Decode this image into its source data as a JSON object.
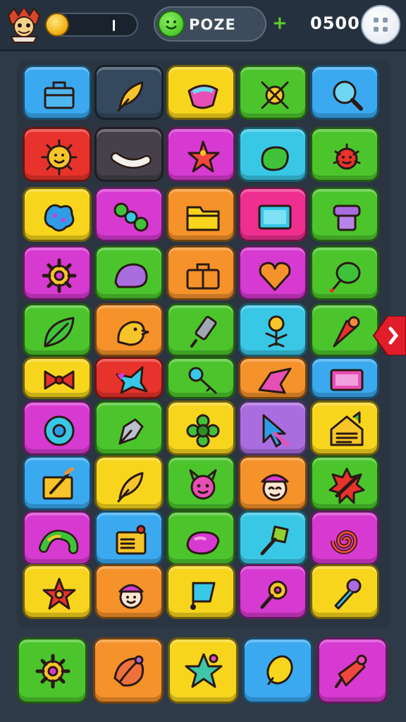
{
  "header": {
    "mode_label": "POZE",
    "score": "0500",
    "plus_symbol": "+"
  },
  "colors": {
    "background": "#2f3a48",
    "accent_green": "#5cd02a",
    "side_tab": "#e11d2a"
  },
  "palette": {
    "blue": "#3aa9f0",
    "navy": "#34495e",
    "yellow": "#f7d51d",
    "green": "#4cc52d",
    "red": "#e8322c",
    "dark": "#45404a",
    "magenta": "#d63ad0",
    "cyan": "#39c7e6",
    "orange": "#f5922a",
    "lime": "#8fd22f",
    "purple": "#a96ddf",
    "pink": "#ee2f8f"
  },
  "board": {
    "rows": [
      [
        {
          "color": "blue",
          "icon": "bag-icon"
        },
        {
          "color": "navy",
          "icon": "feather-icon"
        },
        {
          "color": "yellow",
          "icon": "gem-icon"
        },
        {
          "color": "green",
          "icon": "cross-ring-icon"
        },
        {
          "color": "blue",
          "icon": "magnifier-icon"
        }
      ],
      [
        {
          "color": "red",
          "icon": "sun-face-icon"
        },
        {
          "color": "dark",
          "icon": "worm-icon"
        },
        {
          "color": "magenta",
          "icon": "star-bolt-icon"
        },
        {
          "color": "cyan",
          "icon": "frog-icon"
        },
        {
          "color": "green",
          "icon": "bug-icon"
        }
      ],
      [
        {
          "color": "yellow",
          "icon": "blob-icon"
        },
        {
          "color": "magenta",
          "icon": "beads-icon"
        },
        {
          "color": "orange",
          "icon": "folder-icon"
        },
        {
          "color": "pink",
          "icon": "screen-icon"
        },
        {
          "color": "green",
          "icon": "jar-icon"
        }
      ],
      [
        {
          "color": "magenta",
          "icon": "gear-icon"
        },
        {
          "color": "green",
          "icon": "slug-icon"
        },
        {
          "color": "orange",
          "icon": "suitcase-icon"
        },
        {
          "color": "magenta",
          "icon": "heart-icon"
        },
        {
          "color": "green",
          "icon": "balloon-icon"
        }
      ],
      [
        {
          "color": "green",
          "icon": "leaf-icon"
        },
        {
          "color": "orange",
          "icon": "chick-icon"
        },
        {
          "color": "green",
          "icon": "marker-icon"
        },
        {
          "color": "cyan",
          "icon": "plant-icon"
        },
        {
          "color": "green",
          "icon": "cone-icon"
        }
      ],
      [
        {
          "color": "yellow",
          "icon": "bow-icon"
        },
        {
          "color": "red",
          "icon": "star-fish-icon"
        },
        {
          "color": "green",
          "icon": "key-icon"
        },
        {
          "color": "orange",
          "icon": "shard-icon"
        },
        {
          "color": "blue",
          "icon": "frame-icon"
        }
      ],
      [
        {
          "color": "magenta",
          "icon": "donut-icon"
        },
        {
          "color": "green",
          "icon": "pen-icon"
        },
        {
          "color": "yellow",
          "icon": "flower-icon"
        },
        {
          "color": "purple",
          "icon": "cursor-icon"
        },
        {
          "color": "yellow",
          "icon": "house-icon"
        }
      ],
      [
        {
          "color": "blue",
          "icon": "easel-icon"
        },
        {
          "color": "yellow",
          "icon": "feather-icon"
        },
        {
          "color": "green",
          "icon": "devil-icon"
        },
        {
          "color": "orange",
          "icon": "face-hat-icon"
        },
        {
          "color": "green",
          "icon": "burst-icon"
        }
      ],
      [
        {
          "color": "magenta",
          "icon": "snake-icon"
        },
        {
          "color": "blue",
          "icon": "radio-icon"
        },
        {
          "color": "green",
          "icon": "lips-icon"
        },
        {
          "color": "cyan",
          "icon": "shovel-icon"
        },
        {
          "color": "magenta",
          "icon": "spiral-icon"
        }
      ],
      [
        {
          "color": "yellow",
          "icon": "flower-star-icon"
        },
        {
          "color": "orange",
          "icon": "face-cap-icon"
        },
        {
          "color": "yellow",
          "icon": "flag-icon"
        },
        {
          "color": "magenta",
          "icon": "key-ring-icon"
        },
        {
          "color": "yellow",
          "icon": "mic-icon"
        }
      ]
    ]
  },
  "tray": {
    "tiles": [
      {
        "color": "green",
        "icon": "gear-icon"
      },
      {
        "color": "orange",
        "icon": "shell-icon"
      },
      {
        "color": "yellow",
        "icon": "star-icon"
      },
      {
        "color": "blue",
        "icon": "lemon-icon"
      },
      {
        "color": "magenta",
        "icon": "rocket-icon"
      }
    ]
  }
}
